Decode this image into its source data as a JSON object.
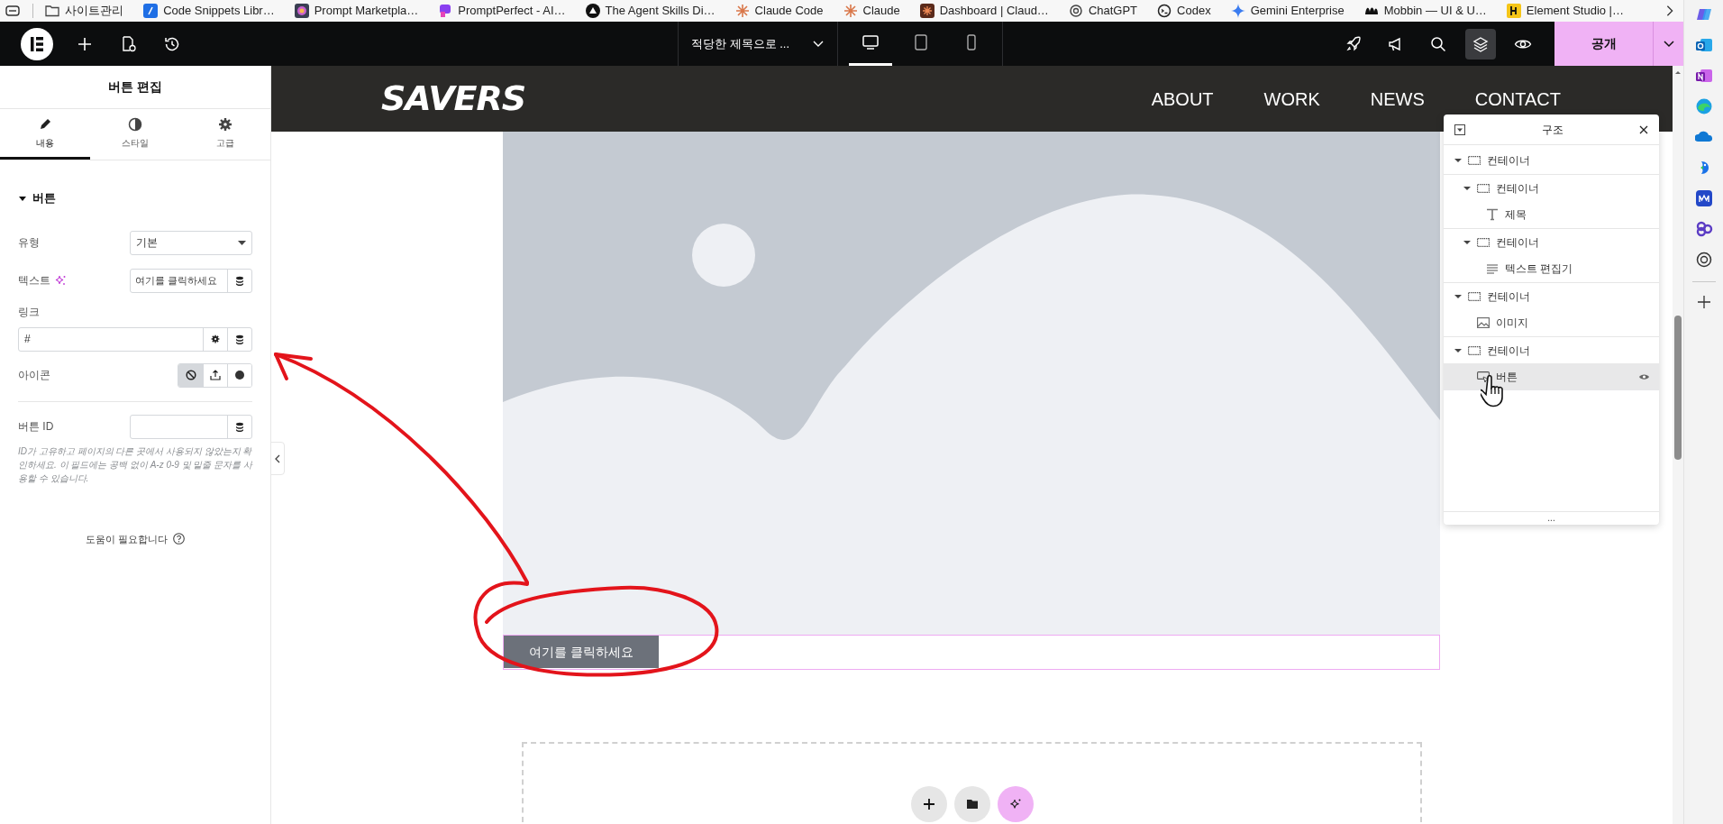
{
  "bookmarks": [
    {
      "label": "사이트관리",
      "kind": "folder"
    },
    {
      "label": "Code Snippets Libr…",
      "kind": "code"
    },
    {
      "label": "Prompt Marketpla…",
      "kind": "gradient"
    },
    {
      "label": "PromptPerfect - AI…",
      "kind": "perfect"
    },
    {
      "label": "The Agent Skills Di…",
      "kind": "triangle"
    },
    {
      "label": "Claude Code",
      "kind": "starburst"
    },
    {
      "label": "Claude",
      "kind": "starburst"
    },
    {
      "label": "Dashboard | Claud…",
      "kind": "dashboard"
    },
    {
      "label": "ChatGPT",
      "kind": "knot"
    },
    {
      "label": "Codex",
      "kind": "codex"
    },
    {
      "label": "Gemini Enterprise",
      "kind": "sparkle"
    },
    {
      "label": "Mobbin — UI & U…",
      "kind": "mobbin"
    },
    {
      "label": "Element Studio |…",
      "kind": "element"
    }
  ],
  "toolbar": {
    "page_title": "적당한 제목으로 ...",
    "publish": "공개",
    "devices": [
      {
        "kind": "desktop",
        "selected": true
      },
      {
        "kind": "tablet",
        "selected": false
      },
      {
        "kind": "mobile",
        "selected": false
      }
    ],
    "tools": [
      {
        "kind": "rocket",
        "selected": false
      },
      {
        "kind": "megaphone",
        "selected": false
      },
      {
        "kind": "search",
        "selected": false
      },
      {
        "kind": "layers",
        "selected": true
      },
      {
        "kind": "eye",
        "selected": false
      }
    ]
  },
  "panel": {
    "title": "버튼 편집",
    "tabs": [
      {
        "label": "내용",
        "kind": "pencil",
        "selected": true
      },
      {
        "label": "스타일",
        "kind": "contrast",
        "selected": false
      },
      {
        "label": "고급",
        "kind": "gear",
        "selected": false
      }
    ],
    "section": {
      "title": "버튼",
      "expanded": true
    },
    "type": {
      "label": "유형",
      "value": "기본"
    },
    "text": {
      "label": "텍스트",
      "value": "여기를 클릭하세요"
    },
    "link": {
      "label": "링크",
      "value": "#"
    },
    "icon": {
      "label": "아이콘",
      "options": [
        {
          "kind": "none",
          "selected": true
        },
        {
          "kind": "upload",
          "selected": false
        },
        {
          "kind": "circle",
          "selected": false
        }
      ]
    },
    "button_id": {
      "label": "버튼 ID"
    },
    "note": "ID가 고유하고 페이지의 다른 곳에서 사용되지 않았는지 확인하세요. 이 필드에는 공백 없이 A-z  0-9 및 밑줄 문자를 사용할 수 있습니다.",
    "help": "도움이 필요합니다"
  },
  "site": {
    "logo": "SAVERS",
    "nav": [
      "ABOUT",
      "WORK",
      "NEWS",
      "CONTACT"
    ],
    "button": "여기를 클릭하세요",
    "add_actions": [
      {
        "kind": "plus"
      },
      {
        "kind": "folder"
      },
      {
        "kind": "ai"
      }
    ]
  },
  "structure": {
    "title": "구조",
    "items": [
      {
        "label": "컨테이너",
        "kind": "container",
        "expanded": true,
        "selected": false,
        "children": [
          {
            "label": "컨테이너",
            "kind": "container",
            "expanded": true,
            "selected": false,
            "children": [
              {
                "label": "제목",
                "kind": "heading",
                "selected": false
              }
            ]
          },
          {
            "label": "컨테이너",
            "kind": "container",
            "expanded": true,
            "selected": false,
            "children": [
              {
                "label": "텍스트 편집기",
                "kind": "text",
                "selected": false
              }
            ]
          }
        ]
      },
      {
        "label": "컨테이너",
        "kind": "container",
        "expanded": true,
        "selected": false,
        "children": [
          {
            "label": "이미지",
            "kind": "image",
            "selected": false
          }
        ]
      },
      {
        "label": "컨테이너",
        "kind": "container",
        "expanded": true,
        "selected": false,
        "children": [
          {
            "label": "버튼",
            "kind": "button",
            "selected": true
          }
        ]
      }
    ],
    "more": "..."
  }
}
